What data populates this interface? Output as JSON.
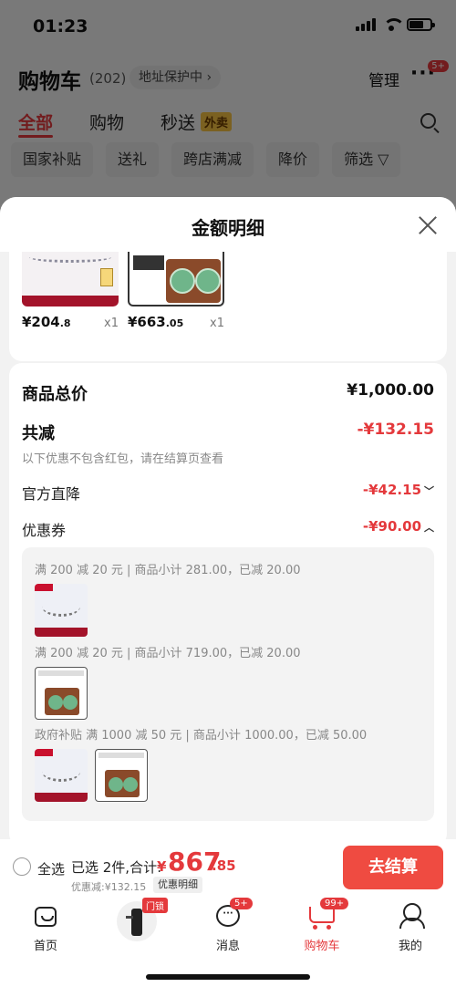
{
  "status": {
    "time": "01:23"
  },
  "header": {
    "title": "购物车",
    "count": "(202)",
    "address": "地址保护中 ›",
    "manage": "管理",
    "more": "···",
    "more_badge": "5+"
  },
  "tabs": [
    {
      "label": "全部"
    },
    {
      "label": "购物"
    },
    {
      "label": "秒送"
    }
  ],
  "tab_badge": "外卖",
  "filters": [
    "国家补贴",
    "送礼",
    "跨店满减",
    "降价",
    "筛选 ▽"
  ],
  "sheet": {
    "title": "金额明细"
  },
  "products": [
    {
      "price_main": "¥204",
      "price_dec": ".8",
      "qty": "x1"
    },
    {
      "price_main": "¥663",
      "price_dec": ".05",
      "qty": "x1"
    }
  ],
  "summary": {
    "total_label": "商品总价",
    "total_value": "¥1,000.00",
    "reduce_label": "共减",
    "reduce_value": "-¥132.15",
    "note": "以下优惠不包含红包，请在结算页查看",
    "gov_label": "官方直降",
    "gov_value": "-¥42.15",
    "coupon_label": "优惠券",
    "coupon_value": "-¥90.00"
  },
  "coupons": [
    "满 200 减 20 元 | 商品小计 281.00，已减 20.00",
    "满 200 减 20 元 | 商品小计 719.00，已减 20.00",
    "政府补贴 满 1000 减 50 元 | 商品小计 1000.00，已减 50.00"
  ],
  "checkout": {
    "select_all": "全选",
    "selected": "已选 2件,合计:",
    "yen": "¥",
    "total_int": "867",
    "total_dec": ".85",
    "discount": "优惠减:¥132.15",
    "detail": "优惠明细",
    "button": "去结算"
  },
  "tabbar": [
    {
      "label": "首页"
    },
    {
      "label": ""
    },
    {
      "label": "消息"
    },
    {
      "label": "购物车"
    },
    {
      "label": "我的"
    }
  ],
  "tabbar_badges": {
    "promo": "门锁",
    "msg": "5+",
    "cart": "99+"
  },
  "colors": {
    "accent": "#e4393c",
    "button": "#ef4b41"
  }
}
